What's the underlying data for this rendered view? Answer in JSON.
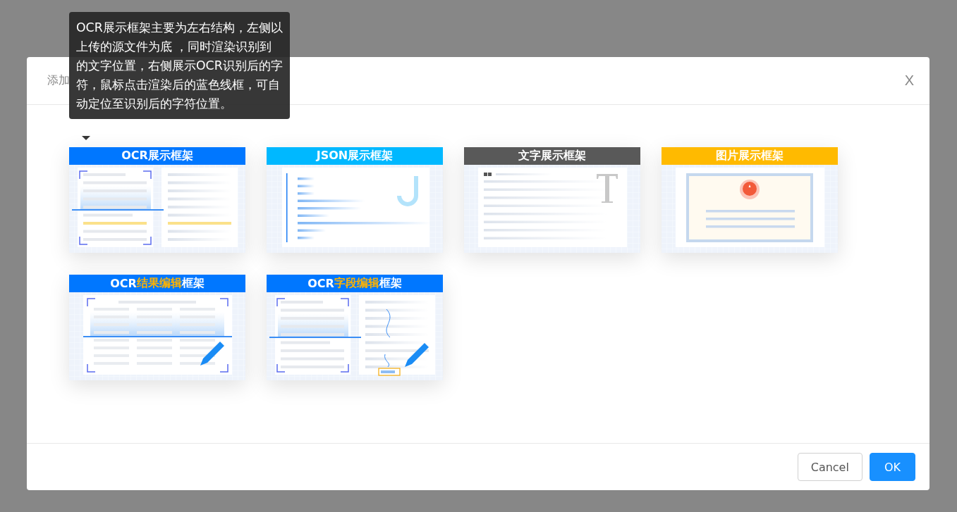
{
  "dialog": {
    "title": "添加",
    "close": "X"
  },
  "tooltip": {
    "text": "OCR展示框架主要为左右结构，左侧以上传的源文件为底 ，同时渲染识别到的文字位置，右侧展示OCR识别后的字符，鼠标点击渲染后的蓝色线框，可自动定位至识别后的字符位置。"
  },
  "cards": [
    {
      "kind": "ocr",
      "color": "#0077ff",
      "title": [
        {
          "text": "OCR展示框架",
          "highlight": false
        }
      ]
    },
    {
      "kind": "json",
      "color": "#00b8ff",
      "title": [
        {
          "text": "JSON展示框架",
          "highlight": false
        }
      ]
    },
    {
      "kind": "text",
      "color": "#595959",
      "title": [
        {
          "text": "文字展示框架",
          "highlight": false
        }
      ]
    },
    {
      "kind": "image",
      "color": "#ffba00",
      "title": [
        {
          "text": "图片展示框架",
          "highlight": false
        }
      ]
    },
    {
      "kind": "ocr-edit",
      "color": "#0077ff",
      "title": [
        {
          "text": "OCR",
          "highlight": false
        },
        {
          "text": "结果编辑",
          "highlight": true
        },
        {
          "text": "框架",
          "highlight": false
        }
      ]
    },
    {
      "kind": "field-edit",
      "color": "#0077ff",
      "title": [
        {
          "text": "OCR",
          "highlight": false
        },
        {
          "text": "字段编辑",
          "highlight": true
        },
        {
          "text": "框架",
          "highlight": false
        }
      ]
    }
  ],
  "buttons": [
    {
      "label": "Cancel",
      "kind": "default"
    },
    {
      "label": "OK",
      "kind": "primary"
    }
  ]
}
